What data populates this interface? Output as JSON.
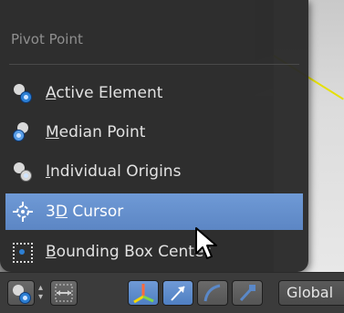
{
  "menu": {
    "title": "Pivot Point",
    "items": [
      {
        "prefix": "",
        "underline": "A",
        "rest": "ctive Element",
        "icon": "active-element-icon",
        "active": false
      },
      {
        "prefix": "",
        "underline": "M",
        "rest": "edian Point",
        "icon": "median-point-icon",
        "active": false
      },
      {
        "prefix": "",
        "underline": "I",
        "rest": "ndividual Origins",
        "icon": "individual-origins-icon",
        "active": false
      },
      {
        "prefix": "3",
        "underline": "D",
        "rest": " Cursor",
        "icon": "cursor-3d-icon",
        "active": true
      },
      {
        "prefix": "",
        "underline": "B",
        "rest": "ounding Box Center",
        "icon": "bounding-box-center-icon",
        "active": false
      }
    ]
  },
  "toolbar": {
    "orientation_label": "Global"
  },
  "colors": {
    "menu_bg": "#2a2a2a",
    "highlight": "#5c86c4",
    "accent_blue": "#2d7fd3"
  }
}
